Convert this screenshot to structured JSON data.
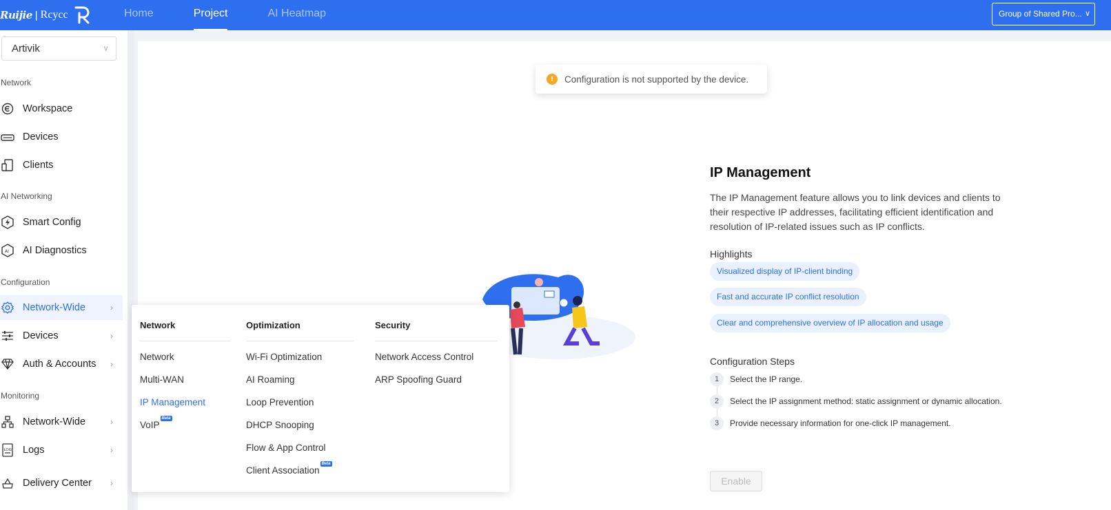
{
  "header": {
    "logo_brand": "Ruijie",
    "logo_sep": "|",
    "logo_brand2": "Rcycc",
    "nav": [
      {
        "label": "Home",
        "active": false
      },
      {
        "label": "Project",
        "active": true
      },
      {
        "label": "AI Heatmap",
        "active": false
      }
    ],
    "group_select": "Group of Shared Pro..."
  },
  "sidebar": {
    "project_select": "Artivik",
    "sections": {
      "network": "Network",
      "ai_networking": "AI Networking",
      "configuration": "Configuration",
      "monitoring": "Monitoring"
    },
    "items": [
      {
        "label": "Workspace",
        "icon": "workspace-icon"
      },
      {
        "label": "Devices",
        "icon": "router-icon"
      },
      {
        "label": "Clients",
        "icon": "clients-icon"
      },
      {
        "label": "Smart Config",
        "icon": "smart-config-icon"
      },
      {
        "label": "AI Diagnostics",
        "icon": "ai-diagnostics-icon"
      },
      {
        "label": "Network-Wide",
        "icon": "gear-icon",
        "active": true
      },
      {
        "label": "Devices",
        "icon": "sliders-icon"
      },
      {
        "label": "Auth & Accounts",
        "icon": "diamond-icon"
      },
      {
        "label": "Network-Wide",
        "icon": "topology-icon"
      },
      {
        "label": "Logs",
        "icon": "logs-icon"
      },
      {
        "label": "Delivery Center",
        "icon": "delivery-icon"
      }
    ]
  },
  "toast": {
    "message": "Configuration is not supported by the device.",
    "icon_glyph": "!"
  },
  "flyout": {
    "network": {
      "heading": "Network",
      "items": [
        "Network",
        "Multi-WAN",
        "IP Management",
        "VoIP"
      ]
    },
    "optimization": {
      "heading": "Optimization",
      "items": [
        "Wi-Fi Optimization",
        "AI Roaming",
        "Loop Prevention",
        "DHCP Snooping",
        "Flow & App Control",
        "Client Association"
      ]
    },
    "security": {
      "heading": "Security",
      "items": [
        "Network Access Control",
        "ARP Spoofing Guard"
      ]
    },
    "beta_label": "Beta"
  },
  "info": {
    "title": "IP Management",
    "description": "The IP Management feature allows you to link devices and clients to their respective IP addresses, facilitating efficient identification and resolution of IP-related issues such as IP conflicts.",
    "highlights_heading": "Highlights",
    "highlights": [
      "Visualized display of IP-client binding",
      "Fast and accurate IP conflict resolution",
      "Clear and comprehensive overview of IP allocation and usage"
    ],
    "steps_heading": "Configuration Steps",
    "steps": [
      {
        "num": "1",
        "text": "Select the IP range."
      },
      {
        "num": "2",
        "text": "Select the IP assignment method: static assignment or dynamic allocation."
      },
      {
        "num": "3",
        "text": "Provide necessary information for one-click IP management."
      }
    ],
    "enable_button": "Enable"
  },
  "colors": {
    "primary": "#2e6ff0",
    "warning": "#f5a623",
    "chip_bg": "#e9f1fe"
  }
}
